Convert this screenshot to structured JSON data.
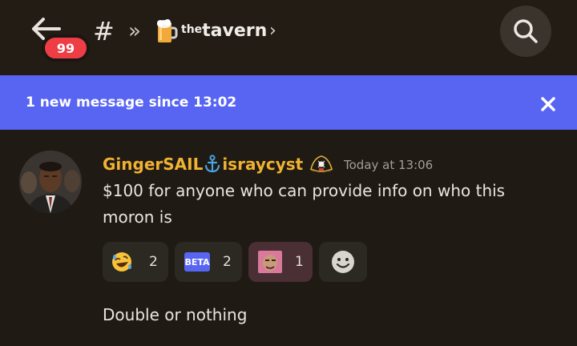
{
  "header": {
    "back_badge": "99",
    "channel_icon": "hash-icon",
    "channel_prefix": "the",
    "channel_name": "tavern"
  },
  "banner": {
    "text": "1 new message since 13:02"
  },
  "message": {
    "username": "GingerSAIL",
    "username_suffix": "israycyst",
    "username_color": "#f0b232",
    "timestamp": "Today at 13:06",
    "text": "$100 for anyone who can provide info on who this moron is"
  },
  "reactions": [
    {
      "emoji": "rofl-emoji",
      "count": "2"
    },
    {
      "emoji": "beta-badge",
      "label": "BETA",
      "count": "2"
    },
    {
      "emoji": "custom-face-emoji",
      "count": "1"
    }
  ],
  "message2": {
    "text": "Double or nothing"
  },
  "colors": {
    "banner": "#5865f2",
    "badge": "#ee3d45",
    "background": "#1f1a14"
  }
}
